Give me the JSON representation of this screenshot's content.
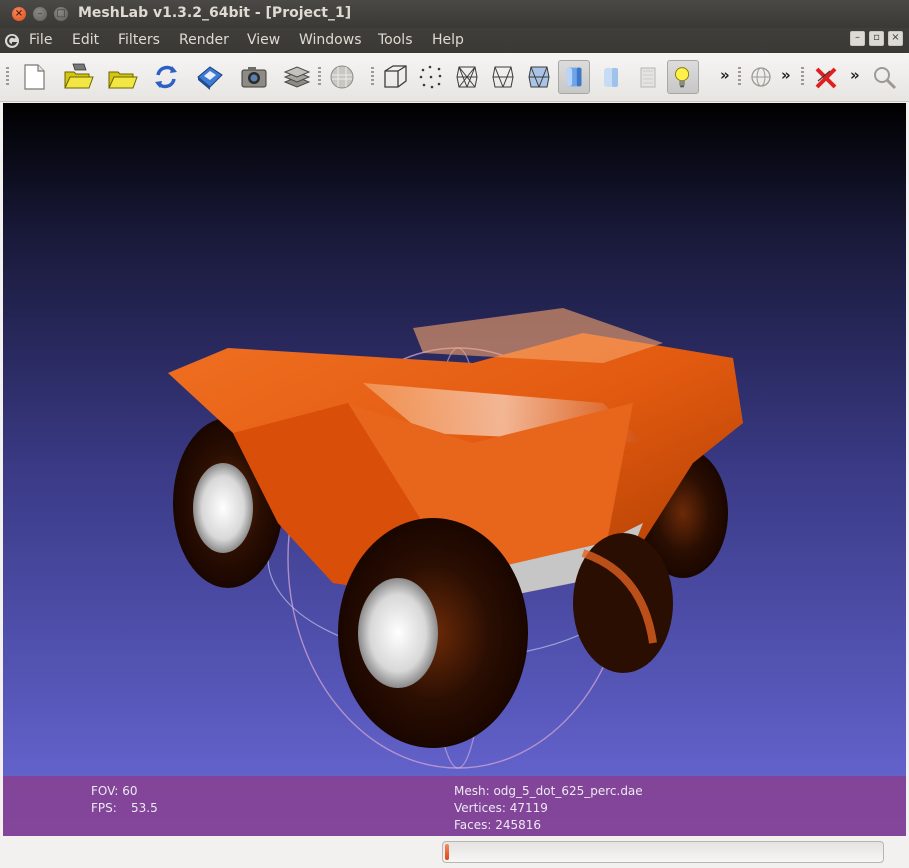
{
  "window": {
    "title": "MeshLab v1.3.2_64bit - [Project_1]"
  },
  "menu": {
    "items": [
      "File",
      "Edit",
      "Filters",
      "Render",
      "View",
      "Windows",
      "Tools",
      "Help"
    ]
  },
  "toolbar": {
    "icons": [
      "new-document-icon",
      "open-mesh-icon",
      "open-project-icon",
      "reload-icon",
      "save-icon",
      "snapshot-icon",
      "layers-icon",
      "bounding-box-icon",
      "point-cloud-icon",
      "wireframe-icon",
      "hidden-lines-icon",
      "flat-lines-icon",
      "flat-shading-icon",
      "smooth-shading-icon",
      "texture-icon",
      "light-bulb-icon",
      "trackball-icon",
      "delete-selection-icon",
      "zoom-icon"
    ],
    "overflow_label": "»"
  },
  "viewport": {
    "background_top": "#000000",
    "background_bottom": "#6a6ad8",
    "model_color": "#e25a10"
  },
  "info": {
    "fov": "FOV: 60",
    "fps_label": "FPS:",
    "fps_value": "53.5",
    "mesh": "Mesh: odg_5_dot_625_perc.dae",
    "vertices": "Vertices: 47119",
    "faces": "Faces: 245816"
  },
  "status": {
    "progress": 0.01
  },
  "colors": {
    "accent": "#df4a16",
    "info_bar": "#893e8c"
  }
}
